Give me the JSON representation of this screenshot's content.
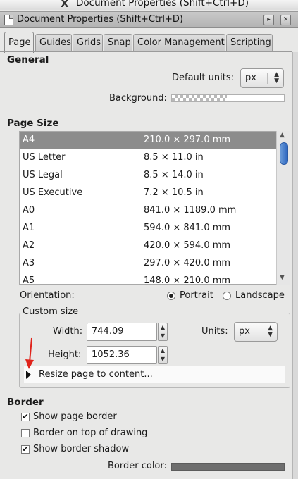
{
  "window": {
    "title": "Document Properties (Shift+Ctrl+D)"
  },
  "dock": {
    "title": "Document Properties (Shift+Ctrl+D)"
  },
  "tabs": [
    {
      "label": "Page",
      "active": true
    },
    {
      "label": "Guides"
    },
    {
      "label": "Grids"
    },
    {
      "label": "Snap"
    },
    {
      "label": "Color Management"
    },
    {
      "label": "Scripting"
    }
  ],
  "general": {
    "title": "General",
    "default_units_label": "Default units:",
    "default_units_value": "px",
    "background_label": "Background:"
  },
  "page_size": {
    "title": "Page Size",
    "rows": [
      {
        "name": "A4",
        "size": "210.0 × 297.0 mm",
        "selected": true
      },
      {
        "name": "US Letter",
        "size": "8.5 × 11.0 in"
      },
      {
        "name": "US Legal",
        "size": "8.5 × 14.0 in"
      },
      {
        "name": "US Executive",
        "size": "7.2 × 10.5 in"
      },
      {
        "name": "A0",
        "size": "841.0 × 1189.0 mm"
      },
      {
        "name": "A1",
        "size": "594.0 × 841.0 mm"
      },
      {
        "name": "A2",
        "size": "420.0 × 594.0 mm"
      },
      {
        "name": "A3",
        "size": "297.0 × 420.0 mm"
      },
      {
        "name": "A5",
        "size": "148.0 × 210.0 mm"
      }
    ],
    "orientation_label": "Orientation:",
    "portrait_label": "Portrait",
    "landscape_label": "Landscape",
    "orientation_value": "portrait"
  },
  "custom_size": {
    "title": "Custom size",
    "width_label": "Width:",
    "width_value": "744.09",
    "height_label": "Height:",
    "height_value": "1052.36",
    "units_label": "Units:",
    "units_value": "px",
    "resize_label": "Resize page to content..."
  },
  "border": {
    "title": "Border",
    "show_border_label": "Show page border",
    "show_border_checked": true,
    "border_on_top_label": "Border on top of drawing",
    "border_on_top_checked": false,
    "show_shadow_label": "Show border shadow",
    "show_shadow_checked": true,
    "border_color_label": "Border color:"
  },
  "colors": {
    "selection": "#8c8c8c",
    "scroll_thumb": "#2c66c0",
    "annotation_arrow": "#e0231b",
    "border_color": "#6e6e6e"
  }
}
